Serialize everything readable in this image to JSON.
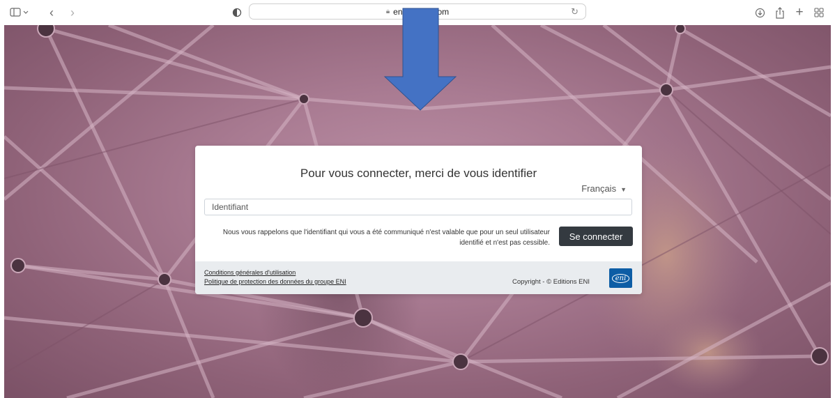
{
  "browser": {
    "url_visible": "en",
    "url_suffix": "com",
    "icons": [
      "sidebar-icon",
      "chevron-down-icon",
      "back-icon",
      "forward-icon",
      "privacy-shield-icon",
      "lock-icon",
      "reload-icon",
      "download-icon",
      "share-icon",
      "new-tab-icon",
      "tab-overview-icon"
    ]
  },
  "login": {
    "title": "Pour vous connecter, merci de vous identifier",
    "language": "Français",
    "identifier_placeholder": "Identifiant",
    "notice": "Nous vous rappelons que l'identifiant qui vous a été communiqué n'est valable que pour un seul utilisateur identifié et n'est pas cessible.",
    "submit_label": "Se connecter"
  },
  "footer": {
    "terms_link": "Conditions générales d'utilisation",
    "privacy_link": "Politique de protection des données du groupe ENI",
    "copyright": "Copyright - © Editions ENI",
    "logo_text": "eni"
  },
  "annotation": {
    "arrow_color": "#4472c4"
  }
}
